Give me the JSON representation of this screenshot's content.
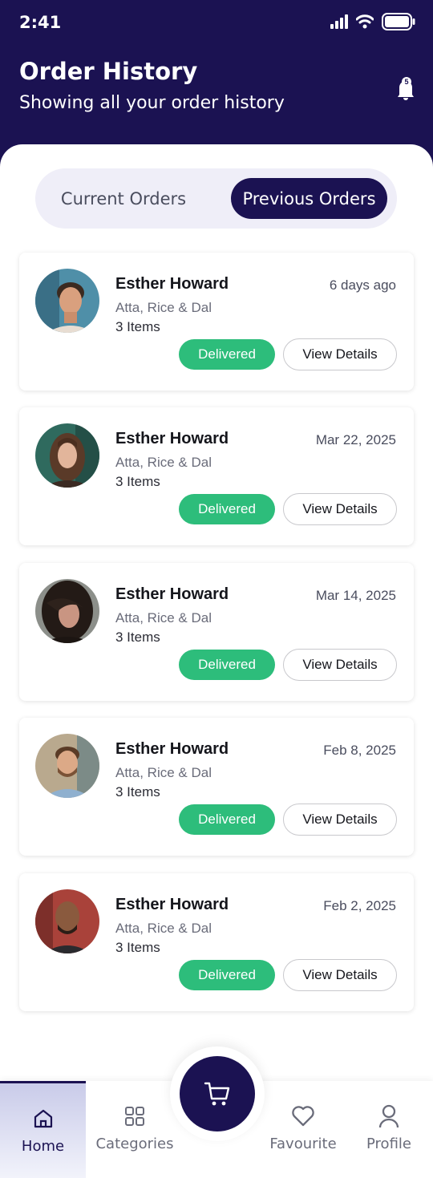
{
  "status_bar": {
    "time": "2:41"
  },
  "header": {
    "title": "Order History",
    "subtitle": "Showing all your order history",
    "notification_count": "5"
  },
  "tabs": [
    {
      "label": "Current Orders",
      "active": false
    },
    {
      "label": "Previous Orders",
      "active": true
    }
  ],
  "orders": [
    {
      "name": "Esther Howard",
      "date": "6 days ago",
      "items_desc": "Atta, Rice & Dal",
      "items_count": "3 Items",
      "status": "Delivered",
      "action": "View Details"
    },
    {
      "name": "Esther Howard",
      "date": "Mar 22, 2025",
      "items_desc": "Atta, Rice & Dal",
      "items_count": "3 Items",
      "status": "Delivered",
      "action": "View Details"
    },
    {
      "name": "Esther Howard",
      "date": "Mar 14, 2025",
      "items_desc": "Atta, Rice & Dal",
      "items_count": "3 Items",
      "status": "Delivered",
      "action": "View Details"
    },
    {
      "name": "Esther Howard",
      "date": "Feb 8, 2025",
      "items_desc": "Atta, Rice & Dal",
      "items_count": "3 Items",
      "status": "Delivered",
      "action": "View Details"
    },
    {
      "name": "Esther Howard",
      "date": "Feb 2, 2025",
      "items_desc": "Atta, Rice & Dal",
      "items_count": "3 Items",
      "status": "Delivered",
      "action": "View Details"
    }
  ],
  "bottom_nav": [
    {
      "label": "Home",
      "icon": "home-icon",
      "active": true
    },
    {
      "label": "Categories",
      "icon": "grid-icon",
      "active": false
    },
    {
      "label": "Favourite",
      "icon": "heart-icon",
      "active": false
    },
    {
      "label": "Profile",
      "icon": "user-icon",
      "active": false
    }
  ],
  "colors": {
    "primary": "#1b1252",
    "success": "#2dbd7b",
    "tab_background": "#efeef8"
  }
}
